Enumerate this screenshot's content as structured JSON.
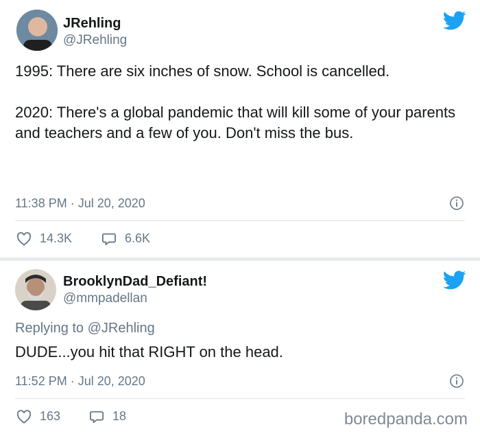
{
  "colors": {
    "twitter_blue": "#1da1f2",
    "muted": "#657786",
    "text": "#14171a"
  },
  "tweet1": {
    "name": "JRehling",
    "handle": "@JRehling",
    "text": "1995: There are six inches of snow. School is cancelled.\n\n2020: There's a global pandemic that will kill some of your parents and teachers and a few of you. Don't miss the bus.",
    "timestamp": "11:38 PM · Jul 20, 2020",
    "likes": "14.3K",
    "replies": "6.6K"
  },
  "tweet2": {
    "name": "BrooklynDad_Defiant!",
    "handle": "@mmpadellan",
    "replying_to": "Replying to @JRehling",
    "text": "DUDE...you hit that RIGHT on the head.",
    "timestamp": "11:52 PM · Jul 20, 2020",
    "likes": "163",
    "replies": "18"
  },
  "watermark": "boredpanda.com",
  "icons": [
    "twitter-bird-icon",
    "info-icon",
    "heart-icon",
    "speech-bubble-icon"
  ]
}
